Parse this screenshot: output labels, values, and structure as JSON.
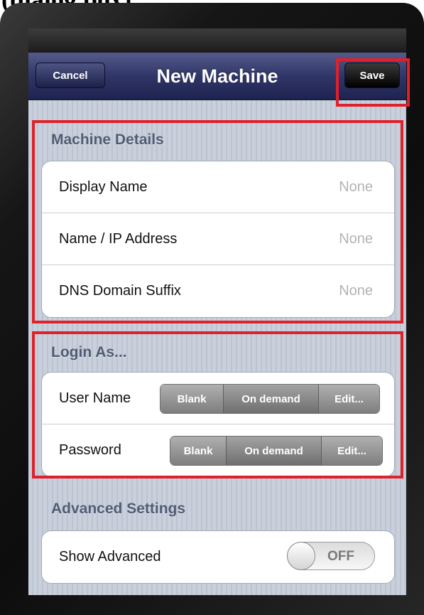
{
  "caption": "(dialog box)",
  "navbar": {
    "title": "New Machine",
    "cancel_label": "Cancel",
    "save_label": "Save"
  },
  "machine_details": {
    "header": "Machine Details",
    "rows": [
      {
        "label": "Display Name",
        "value": "None"
      },
      {
        "label": "Name / IP Address",
        "value": "None"
      },
      {
        "label": "DNS Domain Suffix",
        "value": "None"
      }
    ]
  },
  "login_as": {
    "header": "Login As...",
    "rows": [
      {
        "label": "User Name",
        "options": [
          "Blank",
          "On demand",
          "Edit..."
        ]
      },
      {
        "label": "Password",
        "options": [
          "Blank",
          "On demand",
          "Edit..."
        ]
      }
    ]
  },
  "advanced": {
    "header": "Advanced Settings",
    "show_label": "Show Advanced",
    "toggle_state": "OFF"
  },
  "colors": {
    "highlight": "#e0202a",
    "navbar": "#2f3566",
    "section_header": "#505c74"
  }
}
